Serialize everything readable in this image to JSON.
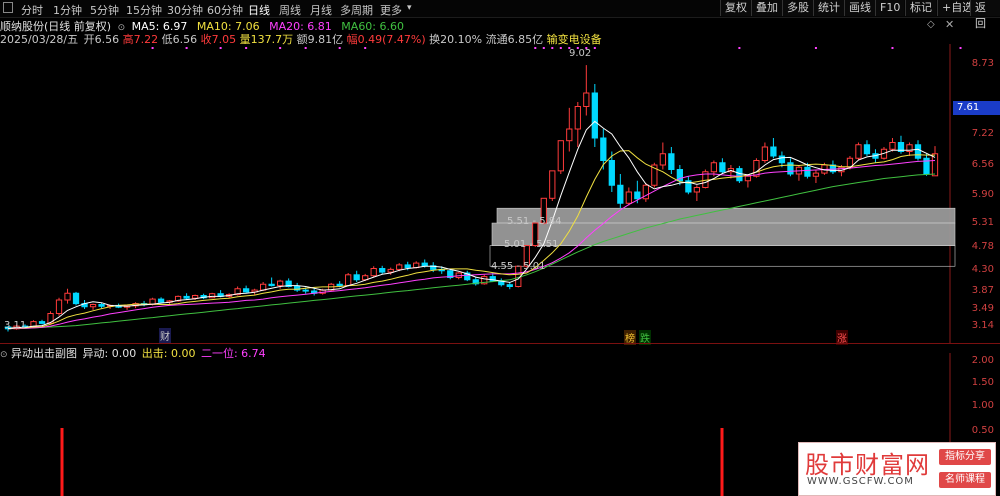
{
  "toolbar": {
    "periods": [
      "分时",
      "1分钟",
      "5分钟",
      "15分钟",
      "30分钟",
      "60分钟",
      "日线",
      "周线",
      "月线",
      "多周期",
      "更多"
    ],
    "active_period": "日线",
    "buttons": [
      "复权",
      "叠加",
      "多股",
      "统计",
      "画线",
      "F10",
      "标记",
      "+自选",
      "返回"
    ]
  },
  "info": {
    "stock_title": "顺纳股份(日线 前复权)",
    "ma5": "MA5: 6.97",
    "ma10": "MA10: 7.06",
    "ma20": "MA20: 6.81",
    "ma60": "MA60: 6.60",
    "date": "2025/03/28/五",
    "open_label": "开",
    "open": "6.56",
    "high_label": "高",
    "high": "7.22",
    "low_label": "低",
    "low": "6.56",
    "close_label": "收",
    "close": "7.05",
    "vol_label": "量",
    "vol": "137.7万",
    "amount_label": "额",
    "amount": "9.81亿",
    "change_label": "幅",
    "change": "0.49(7.47%)",
    "turnover_label": "换",
    "turnover": "20.10%",
    "float_label": "流通",
    "float": "6.85亿",
    "sector": "输变电设备"
  },
  "colors": {
    "up": "#ff3b3b",
    "down": "#00d8ff",
    "ma5": "#ffffff",
    "ma10": "#f0e040",
    "ma20": "#ff40ff",
    "ma60": "#40c040"
  },
  "right_axis": [
    "8.73",
    "7.61",
    "7.22",
    "6.56",
    "5.90",
    "5.31",
    "4.78",
    "4.30",
    "3.87",
    "3.49",
    "3.14"
  ],
  "price_tag": "7.61",
  "annotations": {
    "peak": "9.02",
    "low": "3.11"
  },
  "gaps": [
    "5.51 - 5.84",
    "5.01 - 5.51",
    "4.55 - 5.01"
  ],
  "markers": [
    "财",
    "榜",
    "跌",
    "涨"
  ],
  "sub": {
    "title": "异动出击副图",
    "l1": "异动: 0.00",
    "l2": "出击: 0.00",
    "l3": "二一位: 6.74",
    "axis": [
      "2.00",
      "1.50",
      "1.00",
      "0.50"
    ]
  },
  "watermark": {
    "title": "股市财富网",
    "url": "WWW.GSCFW.COM",
    "badge1": "指标分享",
    "badge2": "名师课程"
  },
  "chart_data": {
    "type": "candlestick",
    "candles": [
      [
        3.2,
        3.22,
        3.1,
        3.16
      ],
      [
        3.16,
        3.25,
        3.14,
        3.22
      ],
      [
        3.22,
        3.26,
        3.17,
        3.19
      ],
      [
        3.19,
        3.35,
        3.18,
        3.32
      ],
      [
        3.32,
        3.36,
        3.26,
        3.28
      ],
      [
        3.28,
        3.55,
        3.27,
        3.5
      ],
      [
        3.5,
        3.85,
        3.45,
        3.8
      ],
      [
        3.8,
        4.05,
        3.72,
        3.95
      ],
      [
        3.95,
        3.98,
        3.68,
        3.72
      ],
      [
        3.72,
        3.8,
        3.6,
        3.65
      ],
      [
        3.65,
        3.72,
        3.58,
        3.7
      ],
      [
        3.7,
        3.74,
        3.62,
        3.66
      ],
      [
        3.66,
        3.7,
        3.6,
        3.68
      ],
      [
        3.68,
        3.72,
        3.62,
        3.64
      ],
      [
        3.64,
        3.7,
        3.58,
        3.67
      ],
      [
        3.67,
        3.75,
        3.62,
        3.72
      ],
      [
        3.72,
        3.78,
        3.66,
        3.7
      ],
      [
        3.7,
        3.85,
        3.68,
        3.82
      ],
      [
        3.82,
        3.86,
        3.72,
        3.75
      ],
      [
        3.75,
        3.8,
        3.68,
        3.78
      ],
      [
        3.78,
        3.9,
        3.76,
        3.88
      ],
      [
        3.88,
        3.95,
        3.8,
        3.84
      ],
      [
        3.84,
        3.92,
        3.8,
        3.9
      ],
      [
        3.9,
        3.94,
        3.82,
        3.85
      ],
      [
        3.85,
        3.96,
        3.84,
        3.94
      ],
      [
        3.94,
        4.02,
        3.86,
        3.88
      ],
      [
        3.88,
        3.95,
        3.84,
        3.92
      ],
      [
        3.92,
        4.1,
        3.9,
        4.05
      ],
      [
        4.05,
        4.12,
        3.96,
        3.98
      ],
      [
        3.98,
        4.05,
        3.92,
        4.02
      ],
      [
        4.02,
        4.2,
        4.0,
        4.15
      ],
      [
        4.15,
        4.3,
        4.1,
        4.12
      ],
      [
        4.12,
        4.25,
        4.05,
        4.22
      ],
      [
        4.22,
        4.28,
        4.08,
        4.1
      ],
      [
        4.1,
        4.18,
        3.98,
        4.02
      ],
      [
        4.02,
        4.08,
        3.94,
        4.0
      ],
      [
        4.0,
        4.06,
        3.9,
        3.95
      ],
      [
        3.95,
        4.05,
        3.92,
        4.02
      ],
      [
        4.02,
        4.18,
        4.0,
        4.15
      ],
      [
        4.15,
        4.22,
        4.08,
        4.12
      ],
      [
        4.12,
        4.4,
        4.1,
        4.36
      ],
      [
        4.36,
        4.45,
        4.2,
        4.25
      ],
      [
        4.25,
        4.38,
        4.22,
        4.34
      ],
      [
        4.34,
        4.55,
        4.3,
        4.5
      ],
      [
        4.5,
        4.56,
        4.38,
        4.42
      ],
      [
        4.42,
        4.52,
        4.36,
        4.48
      ],
      [
        4.48,
        4.62,
        4.44,
        4.58
      ],
      [
        4.58,
        4.65,
        4.46,
        4.52
      ],
      [
        4.52,
        4.66,
        4.5,
        4.62
      ],
      [
        4.62,
        4.7,
        4.52,
        4.56
      ],
      [
        4.56,
        4.64,
        4.42,
        4.48
      ],
      [
        4.48,
        4.55,
        4.38,
        4.45
      ],
      [
        4.45,
        4.5,
        4.26,
        4.3
      ],
      [
        4.3,
        4.42,
        4.26,
        4.4
      ],
      [
        4.4,
        4.45,
        4.22,
        4.25
      ],
      [
        4.25,
        4.3,
        4.12,
        4.16
      ],
      [
        4.16,
        4.36,
        4.14,
        4.32
      ],
      [
        4.32,
        4.4,
        4.2,
        4.22
      ],
      [
        4.22,
        4.28,
        4.1,
        4.14
      ],
      [
        4.14,
        4.2,
        4.04,
        4.1
      ],
      [
        4.1,
        4.55,
        4.08,
        4.55
      ],
      [
        4.55,
        5.01,
        4.52,
        5.01
      ],
      [
        5.01,
        5.51,
        4.98,
        5.51
      ],
      [
        5.51,
        6.06,
        5.48,
        6.06
      ],
      [
        6.06,
        6.67,
        6.0,
        6.67
      ],
      [
        6.67,
        7.34,
        6.6,
        7.34
      ],
      [
        7.34,
        8.07,
        7.1,
        7.6
      ],
      [
        7.6,
        8.2,
        7.2,
        8.1
      ],
      [
        8.1,
        9.02,
        7.9,
        8.4
      ],
      [
        8.4,
        8.6,
        7.2,
        7.4
      ],
      [
        7.4,
        7.6,
        6.7,
        6.9
      ],
      [
        6.9,
        7.1,
        6.2,
        6.35
      ],
      [
        6.35,
        6.6,
        5.84,
        5.95
      ],
      [
        5.95,
        6.3,
        5.9,
        6.2
      ],
      [
        6.2,
        6.45,
        5.95,
        6.05
      ],
      [
        6.05,
        6.4,
        5.98,
        6.35
      ],
      [
        6.35,
        6.85,
        6.3,
        6.8
      ],
      [
        6.8,
        7.3,
        6.7,
        7.05
      ],
      [
        7.05,
        7.2,
        6.6,
        6.7
      ],
      [
        6.7,
        6.8,
        6.35,
        6.45
      ],
      [
        6.45,
        6.55,
        6.15,
        6.2
      ],
      [
        6.2,
        6.35,
        6.0,
        6.3
      ],
      [
        6.3,
        6.7,
        6.28,
        6.65
      ],
      [
        6.65,
        6.9,
        6.55,
        6.85
      ],
      [
        6.85,
        6.95,
        6.6,
        6.65
      ],
      [
        6.65,
        6.8,
        6.5,
        6.72
      ],
      [
        6.72,
        6.78,
        6.4,
        6.45
      ],
      [
        6.45,
        6.6,
        6.3,
        6.55
      ],
      [
        6.55,
        6.95,
        6.52,
        6.9
      ],
      [
        6.9,
        7.3,
        6.85,
        7.2
      ],
      [
        7.2,
        7.4,
        6.95,
        7.0
      ],
      [
        7.0,
        7.1,
        6.75,
        6.85
      ],
      [
        6.85,
        6.95,
        6.55,
        6.6
      ],
      [
        6.6,
        6.8,
        6.45,
        6.75
      ],
      [
        6.75,
        6.85,
        6.5,
        6.55
      ],
      [
        6.55,
        6.7,
        6.4,
        6.62
      ],
      [
        6.62,
        6.85,
        6.58,
        6.8
      ],
      [
        6.8,
        6.9,
        6.6,
        6.65
      ],
      [
        6.65,
        6.8,
        6.55,
        6.75
      ],
      [
        6.75,
        7.0,
        6.7,
        6.95
      ],
      [
        6.95,
        7.3,
        6.9,
        7.25
      ],
      [
        7.25,
        7.35,
        7.0,
        7.05
      ],
      [
        7.05,
        7.15,
        6.85,
        6.95
      ],
      [
        6.95,
        7.2,
        6.92,
        7.15
      ],
      [
        7.15,
        7.4,
        7.1,
        7.3
      ],
      [
        7.3,
        7.45,
        7.05,
        7.1
      ],
      [
        7.1,
        7.3,
        7.0,
        7.25
      ],
      [
        7.25,
        7.35,
        6.9,
        6.95
      ],
      [
        6.95,
        7.05,
        6.56,
        6.6
      ],
      [
        6.56,
        7.22,
        6.56,
        7.05
      ]
    ],
    "ma5": [
      3.16,
      3.19,
      3.19,
      3.22,
      3.23,
      3.3,
      3.42,
      3.57,
      3.65,
      3.72,
      3.76,
      3.74,
      3.68,
      3.67,
      3.66,
      3.68,
      3.69,
      3.71,
      3.73,
      3.75,
      3.79,
      3.81,
      3.83,
      3.86,
      3.88,
      3.88,
      3.9,
      3.94,
      3.95,
      3.97,
      4.02,
      4.06,
      4.1,
      4.12,
      4.12,
      4.1,
      4.06,
      4.02,
      4.03,
      4.05,
      4.12,
      4.17,
      4.24,
      4.31,
      4.37,
      4.4,
      4.46,
      4.5,
      4.52,
      4.55,
      4.55,
      4.53,
      4.48,
      4.44,
      4.38,
      4.31,
      4.27,
      4.25,
      4.22,
      4.19,
      4.27,
      4.49,
      4.75,
      5.05,
      5.56,
      6.12,
      6.64,
      7.15,
      7.58,
      7.77,
      7.62,
      7.49,
      7.21,
      6.96,
      6.65,
      6.38,
      6.27,
      6.32,
      6.35,
      6.4,
      6.42,
      6.37,
      6.41,
      6.5,
      6.61,
      6.68,
      6.61,
      6.58,
      6.65,
      6.8,
      6.92,
      6.96,
      6.97,
      6.89,
      6.8,
      6.74,
      6.69,
      6.68,
      6.68,
      6.74,
      6.91,
      6.98,
      7.01,
      7.06,
      7.13,
      7.13,
      7.13,
      7.15,
      7.06,
      6.97
    ],
    "ma10": [
      3.16,
      3.18,
      3.18,
      3.2,
      3.21,
      3.26,
      3.33,
      3.42,
      3.47,
      3.51,
      3.56,
      3.61,
      3.65,
      3.68,
      3.69,
      3.71,
      3.71,
      3.71,
      3.7,
      3.7,
      3.72,
      3.75,
      3.77,
      3.79,
      3.81,
      3.83,
      3.84,
      3.87,
      3.89,
      3.91,
      3.95,
      3.98,
      4.02,
      4.04,
      4.04,
      4.06,
      4.08,
      4.09,
      4.09,
      4.1,
      4.12,
      4.13,
      4.15,
      4.19,
      4.22,
      4.26,
      4.31,
      4.35,
      4.4,
      4.43,
      4.46,
      4.48,
      4.49,
      4.49,
      4.49,
      4.46,
      4.44,
      4.41,
      4.38,
      4.36,
      4.37,
      4.4,
      4.52,
      4.68,
      4.85,
      5.05,
      5.33,
      5.67,
      6.09,
      6.48,
      6.81,
      7.0,
      7.11,
      7.12,
      6.96,
      6.82,
      6.73,
      6.65,
      6.53,
      6.43,
      6.4,
      6.43,
      6.46,
      6.48,
      6.51,
      6.53,
      6.54,
      6.58,
      6.64,
      6.71,
      6.76,
      6.79,
      6.8,
      6.79,
      6.81,
      6.82,
      6.81,
      6.79,
      6.76,
      6.76,
      6.79,
      6.82,
      6.85,
      6.87,
      6.92,
      6.99,
      7.02,
      7.03,
      7.02,
      7.02
    ],
    "ma20": [
      3.16,
      3.17,
      3.17,
      3.18,
      3.19,
      3.22,
      3.26,
      3.31,
      3.35,
      3.38,
      3.42,
      3.45,
      3.49,
      3.52,
      3.55,
      3.58,
      3.61,
      3.64,
      3.66,
      3.68,
      3.69,
      3.7,
      3.71,
      3.72,
      3.73,
      3.74,
      3.75,
      3.77,
      3.79,
      3.8,
      3.82,
      3.85,
      3.87,
      3.89,
      3.91,
      3.93,
      3.95,
      3.97,
      3.99,
      4.01,
      4.03,
      4.05,
      4.07,
      4.1,
      4.13,
      4.15,
      4.18,
      4.21,
      4.24,
      4.26,
      4.29,
      4.31,
      4.32,
      4.34,
      4.35,
      4.36,
      4.37,
      4.38,
      4.38,
      4.38,
      4.4,
      4.43,
      4.48,
      4.55,
      4.63,
      4.73,
      4.85,
      5.0,
      5.18,
      5.35,
      5.5,
      5.66,
      5.8,
      5.92,
      6.02,
      6.12,
      6.22,
      6.32,
      6.41,
      6.5,
      6.55,
      6.58,
      6.6,
      6.6,
      6.58,
      6.56,
      6.55,
      6.56,
      6.58,
      6.62,
      6.64,
      6.65,
      6.66,
      6.67,
      6.68,
      6.69,
      6.7,
      6.71,
      6.72,
      6.73,
      6.75,
      6.77,
      6.79,
      6.8,
      6.82,
      6.84,
      6.86,
      6.88,
      6.89,
      6.9
    ],
    "ma60": [
      3.16,
      3.17,
      3.17,
      3.18,
      3.19,
      3.2,
      3.21,
      3.22,
      3.23,
      3.25,
      3.27,
      3.29,
      3.31,
      3.33,
      3.35,
      3.37,
      3.39,
      3.41,
      3.43,
      3.45,
      3.47,
      3.49,
      3.51,
      3.53,
      3.55,
      3.57,
      3.59,
      3.61,
      3.63,
      3.65,
      3.67,
      3.69,
      3.71,
      3.73,
      3.75,
      3.77,
      3.79,
      3.81,
      3.83,
      3.85,
      3.87,
      3.89,
      3.91,
      3.93,
      3.95,
      3.97,
      3.99,
      4.01,
      4.03,
      4.05,
      4.07,
      4.09,
      4.11,
      4.13,
      4.15,
      4.17,
      4.19,
      4.21,
      4.23,
      4.25,
      4.3,
      4.36,
      4.43,
      4.51,
      4.6,
      4.69,
      4.78,
      4.87,
      4.95,
      5.03,
      5.1,
      5.16,
      5.22,
      5.28,
      5.34,
      5.4,
      5.45,
      5.5,
      5.55,
      5.6,
      5.64,
      5.68,
      5.72,
      5.76,
      5.8,
      5.84,
      5.88,
      5.92,
      5.96,
      6.0,
      6.04,
      6.08,
      6.12,
      6.16,
      6.2,
      6.24,
      6.28,
      6.32,
      6.35,
      6.38,
      6.41,
      6.44,
      6.47,
      6.5,
      6.52,
      6.54,
      6.56,
      6.58,
      6.59,
      6.6
    ],
    "signal_bars": [
      [
        20,
        2.0
      ],
      [
        88,
        2.0
      ]
    ],
    "ylim": [
      3.0,
      9.4
    ]
  }
}
